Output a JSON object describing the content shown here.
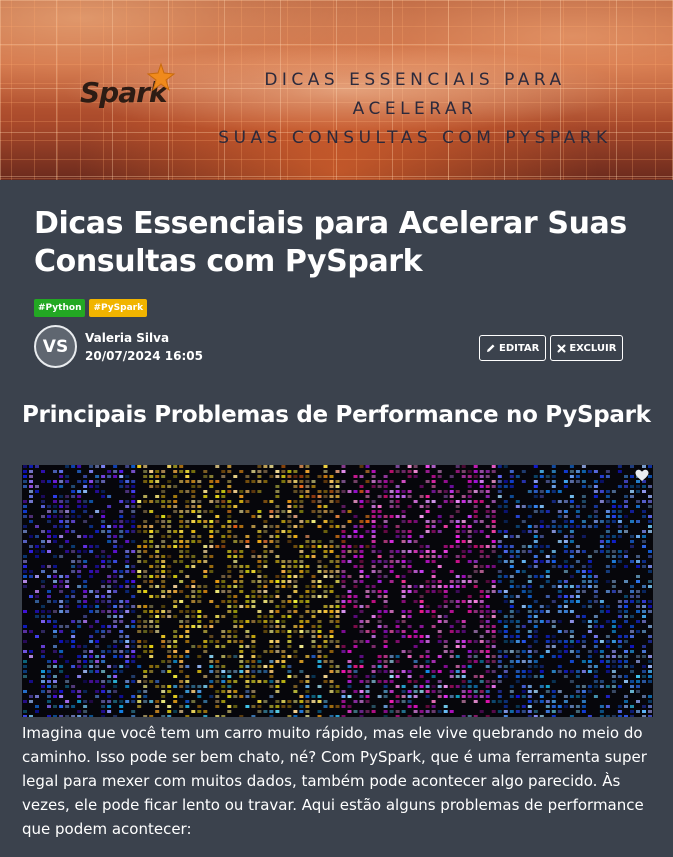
{
  "hero": {
    "logo_text": "Spark",
    "title_line1": "DICAS ESSENCIAIS PARA ACELERAR",
    "title_line2": "SUAS CONSULTAS COM PYSPARK"
  },
  "article": {
    "title": "Dicas Essenciais para Acelerar Suas Consultas com PySpark",
    "tags": [
      "#Python",
      "#PySpark"
    ],
    "author": {
      "initials": "VS",
      "name": "Valeria Silva",
      "date": "20/07/2024 16:05"
    },
    "actions": {
      "edit_label": "EDITAR",
      "delete_label": "EXCLUIR"
    }
  },
  "section": {
    "heading": "Principais Problemas de Performance no PySpark",
    "paragraph": "Imagina que você tem um carro muito rápido, mas ele vive quebrando no meio do caminho. Isso pode ser bem chato, né? Com PySpark, que é uma ferramenta super legal para mexer com muitos dados, também pode acontecer algo parecido. Às vezes, ele pode ficar lento ou travar. Aqui estão alguns problemas de performance que podem acontecer:"
  },
  "icons": {
    "edit": "pencil-icon",
    "delete": "close-icon",
    "like": "heart-icon",
    "logo_star": "star-icon"
  },
  "colors": {
    "background": "#3b424d",
    "tag_python": "#23a823",
    "tag_pyspark": "#f1b400",
    "hero_text": "#2c2a3c"
  }
}
